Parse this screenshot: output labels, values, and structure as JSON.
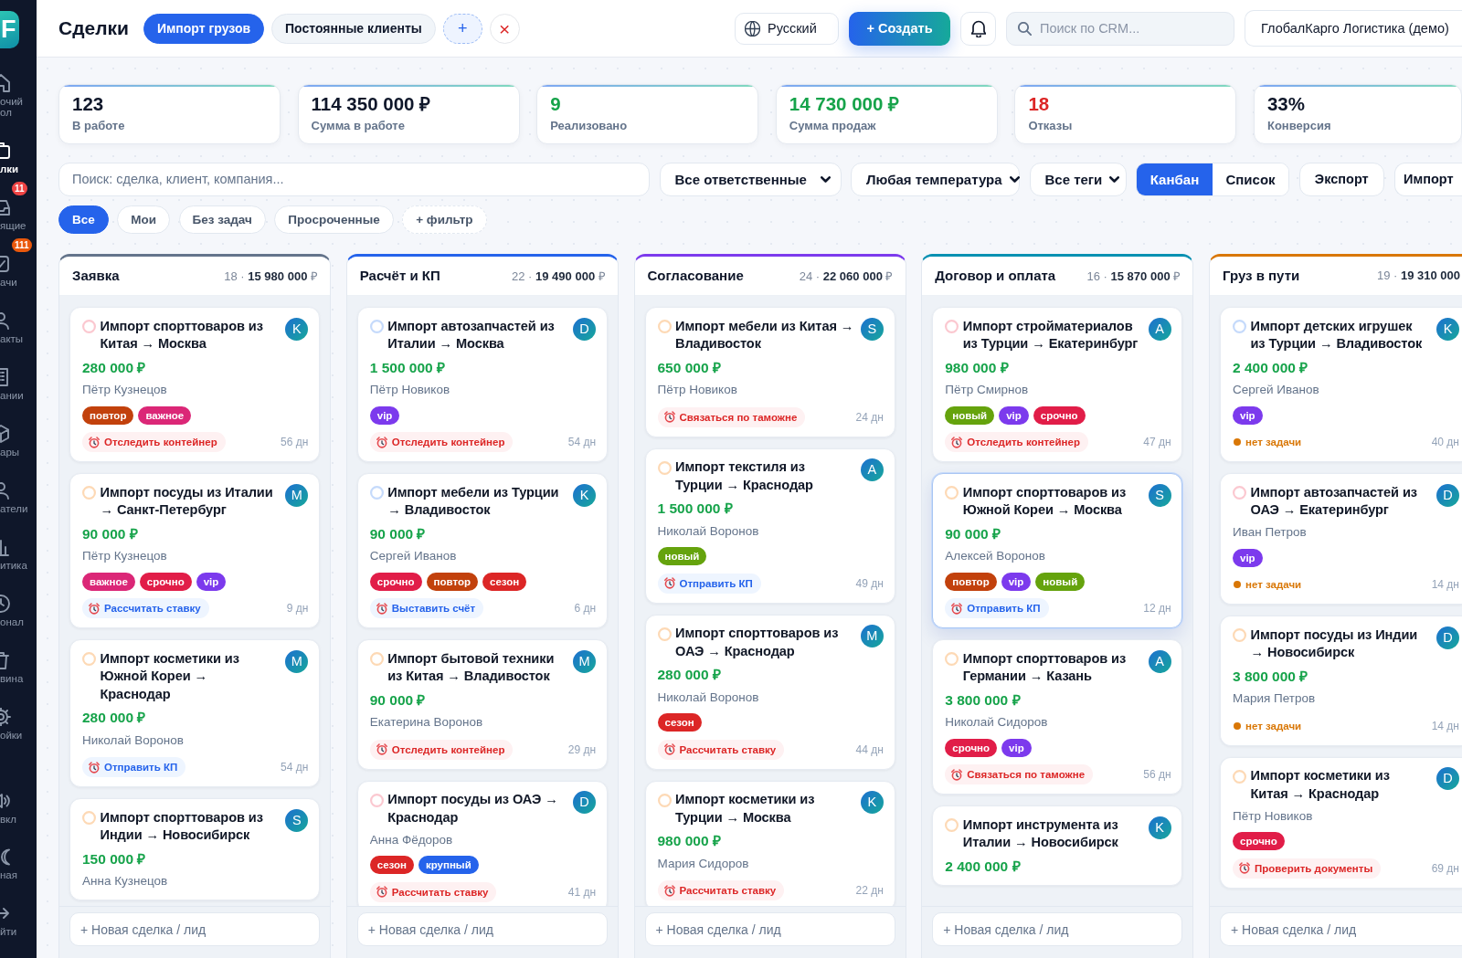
{
  "sidebar": {
    "logo": "F",
    "items": [
      {
        "label": "очий ол",
        "selected": false
      },
      {
        "label": "лки",
        "selected": true
      },
      {
        "label": "ящие",
        "selected": false,
        "badge": {
          "text": "11",
          "color": "#ef4444"
        }
      },
      {
        "label": "ачи",
        "selected": false,
        "badge": {
          "text": "111",
          "color": "#ea580c"
        }
      },
      {
        "label": "акты",
        "selected": false
      },
      {
        "label": "ании",
        "selected": false
      },
      {
        "label": "ары",
        "selected": false
      },
      {
        "label": "атели",
        "selected": false
      },
      {
        "label": "итика",
        "selected": false
      },
      {
        "label": "онал",
        "selected": false
      },
      {
        "label": "вина",
        "selected": false
      },
      {
        "label": "ойки",
        "selected": false
      }
    ],
    "bottom_items": [
      {
        "label": "вкл"
      },
      {
        "label": "ная"
      },
      {
        "label": "йти"
      }
    ]
  },
  "header": {
    "title": "Сделки",
    "pipelines": [
      {
        "label": "Импорт грузов",
        "selected": true
      },
      {
        "label": "Постоянные клиенты",
        "selected": false
      }
    ],
    "add_pipeline": "+",
    "close": "×",
    "language": "Русский",
    "create": "+ Создать",
    "search": {
      "placeholder": "Поиск по CRM..."
    },
    "account": "ГлобалКарго Логистика (демо)"
  },
  "stats": [
    {
      "value": "123",
      "label": "В работе",
      "color": "#0f172a"
    },
    {
      "value": "114 350 000 ₽",
      "label": "Сумма в работе",
      "color": "#0f172a"
    },
    {
      "value": "9",
      "label": "Реализовано",
      "color": "#16a34a"
    },
    {
      "value": "14 730 000 ₽",
      "label": "Сумма продаж",
      "color": "#16a34a"
    },
    {
      "value": "18",
      "label": "Отказы",
      "color": "#dc2626"
    },
    {
      "value": "33%",
      "label": "Конверсия",
      "color": "#0f172a"
    }
  ],
  "filters": {
    "search": {
      "placeholder": "Поиск: сделка, клиент, компания..."
    },
    "dropdowns": [
      "Все ответственные",
      "Любая температура",
      "Все теги"
    ],
    "views": [
      {
        "label": "Канбан",
        "selected": true
      },
      {
        "label": "Список",
        "selected": false
      }
    ],
    "actions": [
      "Экспорт",
      "Импорт"
    ],
    "chips": [
      {
        "label": "Все",
        "selected": true
      },
      {
        "label": "Мои",
        "selected": false
      },
      {
        "label": "Без задач",
        "selected": false
      },
      {
        "label": "Просроченные",
        "selected": false
      }
    ],
    "add_filter": "+ фильтр"
  },
  "board": {
    "columns": [
      {
        "name": "Заявка",
        "summary": "18 · **15 980 000** ₽",
        "color": "#64748b",
        "cards": [
          {
            "title": "Импорт спорттоваров из Китая → Москва",
            "avatar": "K",
            "color": "#fbc8d0",
            "selected": false,
            "amount": "280 000 ₽",
            "contact": "Пётр Кузнецов",
            "tags": [
              {
                "label": "повтор",
                "color": "#c2410c"
              },
              {
                "label": "важное",
                "color": "#db2777"
              }
            ],
            "task": {
              "kind": "reminder",
              "text": "Отследить контейнер",
              "overdue": true
            },
            "age": "56 дн"
          },
          {
            "title": "Импорт посуды из Италии → Санкт-Петербург",
            "avatar": "M",
            "color": "#fdd9b5",
            "selected": false,
            "amount": "90 000 ₽",
            "contact": "Пётр Кузнецов",
            "tags": [
              {
                "label": "важное",
                "color": "#db2777"
              },
              {
                "label": "срочно",
                "color": "#e11d48"
              },
              {
                "label": "vip",
                "color": "#7c3aed"
              }
            ],
            "task": {
              "kind": "reminder",
              "text": "Рассчитать ставку",
              "overdue": false
            },
            "age": "9 дн"
          },
          {
            "title": "Импорт косметики из Южной Кореи → Краснодар",
            "avatar": "M",
            "color": "#fdd9b5",
            "selected": false,
            "amount": "280 000 ₽",
            "contact": "Николай Воронов",
            "task": {
              "kind": "reminder",
              "text": "Отправить КП",
              "overdue": false
            },
            "age": "54 дн"
          },
          {
            "title": "Импорт спорттоваров из Индии → Новосибирск",
            "avatar": "S",
            "color": "#fdd9b5",
            "selected": false,
            "amount": "150 000 ₽",
            "contact": "Анна Кузнецов"
          }
        ],
        "new_deal": {
          "placeholder": "+ Новая сделка / лид"
        }
      },
      {
        "name": "Расчёт и КП",
        "summary": "22 · **19 490 000** ₽",
        "color": "#2563eb",
        "cards": [
          {
            "title": "Импорт автозапчастей из Италии → Москва",
            "avatar": "D",
            "color": "#c5dafb",
            "selected": false,
            "amount": "1 500 000 ₽",
            "contact": "Пётр Новиков",
            "tags": [
              {
                "label": "vip",
                "color": "#7c3aed"
              }
            ],
            "task": {
              "kind": "reminder",
              "text": "Отследить контейнер",
              "overdue": true
            },
            "age": "54 дн"
          },
          {
            "title": "Импорт мебели из Турции → Владивосток",
            "avatar": "K",
            "color": "#c5dafb",
            "selected": false,
            "amount": "90 000 ₽",
            "contact": "Сергей Иванов",
            "tags": [
              {
                "label": "срочно",
                "color": "#e11d48"
              },
              {
                "label": "повтор",
                "color": "#c2410c"
              },
              {
                "label": "сезон",
                "color": "#dc2626"
              }
            ],
            "task": {
              "kind": "reminder",
              "text": "Выставить счёт",
              "overdue": false
            },
            "age": "6 дн"
          },
          {
            "title": "Импорт бытовой техники из Китая → Владивосток",
            "avatar": "M",
            "color": "#fdd9b5",
            "selected": false,
            "amount": "90 000 ₽",
            "contact": "Екатерина Воронов",
            "task": {
              "kind": "reminder",
              "text": "Отследить контейнер",
              "overdue": true
            },
            "age": "29 дн"
          },
          {
            "title": "Импорт посуды из ОАЭ → Краснодар",
            "avatar": "D",
            "color": "#fbc8d0",
            "selected": false,
            "contact": "Анна Фёдоров",
            "tags": [
              {
                "label": "сезон",
                "color": "#dc2626"
              },
              {
                "label": "крупный",
                "color": "#2563eb"
              }
            ],
            "task": {
              "kind": "reminder",
              "text": "Рассчитать ставку",
              "overdue": true
            },
            "age": "41 дн"
          }
        ],
        "new_deal": {
          "placeholder": "+ Новая сделка / лид"
        }
      },
      {
        "name": "Согласование",
        "summary": "24 · **22 060 000** ₽",
        "color": "#7c3aed",
        "cards": [
          {
            "title": "Импорт мебели из Китая → Владивосток",
            "avatar": "S",
            "color": "#fdd9b5",
            "selected": false,
            "amount": "650 000 ₽",
            "contact": "Пётр Новиков",
            "task": {
              "kind": "reminder",
              "text": "Связаться по таможне",
              "overdue": true
            },
            "age": "24 дн"
          },
          {
            "title": "Импорт текстиля из Турции → Краснодар",
            "avatar": "A",
            "color": "#fdd9b5",
            "selected": false,
            "amount": "1 500 000 ₽",
            "contact": "Николай Воронов",
            "tags": [
              {
                "label": "новый",
                "color": "#65a30d"
              }
            ],
            "task": {
              "kind": "reminder",
              "text": "Отправить КП",
              "overdue": false
            },
            "age": "49 дн"
          },
          {
            "title": "Импорт спорттоваров из ОАЭ → Краснодар",
            "avatar": "M",
            "color": "#fdd9b5",
            "selected": false,
            "amount": "280 000 ₽",
            "contact": "Николай Воронов",
            "tags": [
              {
                "label": "сезон",
                "color": "#dc2626"
              }
            ],
            "task": {
              "kind": "reminder",
              "text": "Рассчитать ставку",
              "overdue": true
            },
            "age": "44 дн"
          },
          {
            "title": "Импорт косметики из Турции → Москва",
            "avatar": "K",
            "color": "#fdd9b5",
            "selected": false,
            "amount": "980 000 ₽",
            "contact": "Мария Сидоров",
            "task": {
              "kind": "reminder",
              "text": "Рассчитать ставку",
              "overdue": true
            },
            "age": "22 дн"
          }
        ],
        "new_deal": {
          "placeholder": "+ Новая сделка / лид"
        }
      },
      {
        "name": "Договор и оплата",
        "summary": "16 · **15 870 000** ₽",
        "color": "#0891b2",
        "cards": [
          {
            "title": "Импорт стройматериалов из Турции → Екатеринбург",
            "avatar": "A",
            "color": "#fbc8d0",
            "selected": false,
            "amount": "980 000 ₽",
            "contact": "Пётр Смирнов",
            "tags": [
              {
                "label": "новый",
                "color": "#65a30d"
              },
              {
                "label": "vip",
                "color": "#7c3aed"
              },
              {
                "label": "срочно",
                "color": "#e11d48"
              }
            ],
            "task": {
              "kind": "reminder",
              "text": "Отследить контейнер",
              "overdue": true
            },
            "age": "47 дн"
          },
          {
            "title": "Импорт спорттоваров из Южной Кореи → Москва",
            "avatar": "S",
            "color": "#fdd9b5",
            "selected": true,
            "amount": "90 000 ₽",
            "contact": "Алексей Воронов",
            "tags": [
              {
                "label": "повтор",
                "color": "#c2410c"
              },
              {
                "label": "vip",
                "color": "#7c3aed"
              },
              {
                "label": "новый",
                "color": "#65a30d"
              }
            ],
            "task": {
              "kind": "reminder",
              "text": "Отправить КП",
              "overdue": false
            },
            "age": "12 дн"
          },
          {
            "title": "Импорт спорттоваров из Германии → Казань",
            "avatar": "A",
            "color": "#fdd9b5",
            "selected": false,
            "amount": "3 800 000 ₽",
            "contact": "Николай Сидоров",
            "tags": [
              {
                "label": "срочно",
                "color": "#e11d48"
              },
              {
                "label": "vip",
                "color": "#7c3aed"
              }
            ],
            "task": {
              "kind": "reminder",
              "text": "Связаться по таможне",
              "overdue": true
            },
            "age": "56 дн"
          },
          {
            "title": "Импорт инструмента из Италии → Новосибирск",
            "avatar": "K",
            "color": "#fdd9b5",
            "selected": false,
            "amount": "2 400 000 ₽"
          }
        ],
        "new_deal": {
          "placeholder": "+ Новая сделка / лид"
        }
      },
      {
        "name": "Груз в пути",
        "summary": "19 · **19 310 000**",
        "color": "#d97706",
        "cards": [
          {
            "title": "Импорт детских игрушек из Турции → Владивосток",
            "avatar": "K",
            "color": "#c5dafb",
            "selected": false,
            "amount": "2 400 000 ₽",
            "contact": "Сергей Иванов",
            "tags": [
              {
                "label": "vip",
                "color": "#7c3aed"
              }
            ],
            "task": {
              "kind": "missing",
              "text": "нет задачи"
            },
            "age": "40 дн"
          },
          {
            "title": "Импорт автозапчастей из ОАЭ → Екатеринбург",
            "avatar": "D",
            "color": "#fbc8d0",
            "selected": false,
            "contact": "Иван Петров",
            "tags": [
              {
                "label": "vip",
                "color": "#7c3aed"
              }
            ],
            "task": {
              "kind": "missing",
              "text": "нет задачи"
            },
            "age": "14 дн"
          },
          {
            "title": "Импорт посуды из Индии → Новосибирск",
            "avatar": "D",
            "color": "#fdd9b5",
            "selected": false,
            "amount": "3 800 000 ₽",
            "contact": "Мария Петров",
            "task": {
              "kind": "missing",
              "text": "нет задачи"
            },
            "age": "14 дн"
          },
          {
            "title": "Импорт косметики из Китая → Краснодар",
            "avatar": "D",
            "color": "#fdd9b5",
            "selected": false,
            "contact": "Пётр Новиков",
            "tags": [
              {
                "label": "срочно",
                "color": "#e11d48"
              }
            ],
            "task": {
              "kind": "reminder",
              "text": "Проверить документы",
              "overdue": true
            },
            "age": "69 дн"
          }
        ],
        "new_deal": {
          "placeholder": "+ Новая сделка / лид"
        }
      }
    ]
  }
}
